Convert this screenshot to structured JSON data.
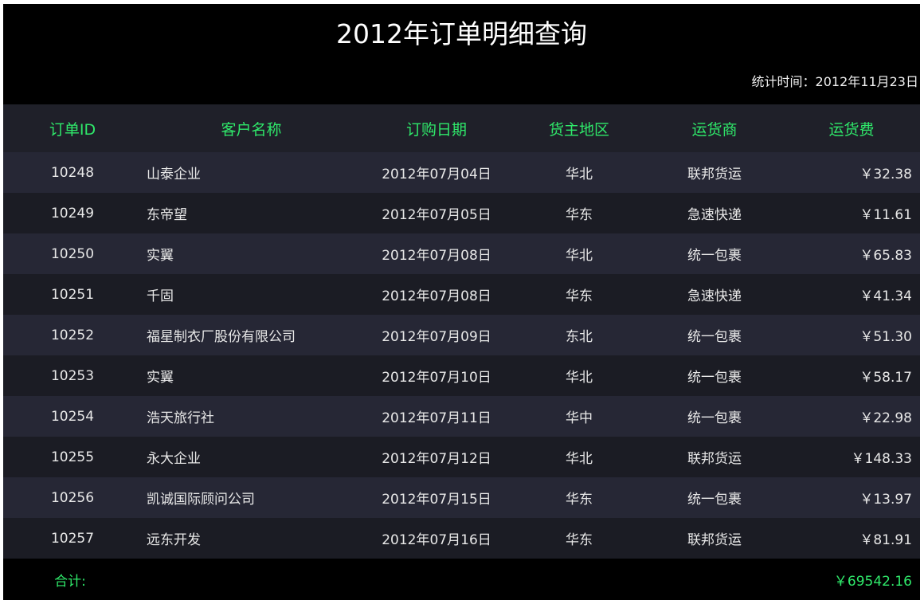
{
  "report": {
    "title": "2012年订单明细查询",
    "stat_time": "统计时间：2012年11月23日"
  },
  "table": {
    "columns": [
      "订单ID",
      "客户名称",
      "订购日期",
      "货主地区",
      "运货商",
      "运货费"
    ],
    "rows": [
      {
        "id": "10248",
        "customer": "山泰企业",
        "date": "2012年07月04日",
        "region": "华北",
        "carrier": "联邦货运",
        "fee": "￥32.38"
      },
      {
        "id": "10249",
        "customer": "东帝望",
        "date": "2012年07月05日",
        "region": "华东",
        "carrier": "急速快递",
        "fee": "￥11.61"
      },
      {
        "id": "10250",
        "customer": "实翼",
        "date": "2012年07月08日",
        "region": "华北",
        "carrier": "统一包裹",
        "fee": "￥65.83"
      },
      {
        "id": "10251",
        "customer": "千固",
        "date": "2012年07月08日",
        "region": "华东",
        "carrier": "急速快递",
        "fee": "￥41.34"
      },
      {
        "id": "10252",
        "customer": "福星制衣厂股份有限公司",
        "date": "2012年07月09日",
        "region": "东北",
        "carrier": "统一包裹",
        "fee": "￥51.30"
      },
      {
        "id": "10253",
        "customer": "实翼",
        "date": "2012年07月10日",
        "region": "华北",
        "carrier": "统一包裹",
        "fee": "￥58.17"
      },
      {
        "id": "10254",
        "customer": "浩天旅行社",
        "date": "2012年07月11日",
        "region": "华中",
        "carrier": "统一包裹",
        "fee": "￥22.98"
      },
      {
        "id": "10255",
        "customer": "永大企业",
        "date": "2012年07月12日",
        "region": "华北",
        "carrier": "联邦货运",
        "fee": "￥148.33"
      },
      {
        "id": "10256",
        "customer": "凯诚国际顾问公司",
        "date": "2012年07月15日",
        "region": "华东",
        "carrier": "统一包裹",
        "fee": "￥13.97"
      },
      {
        "id": "10257",
        "customer": "远东开发",
        "date": "2012年07月16日",
        "region": "华东",
        "carrier": "联邦货运",
        "fee": "￥81.91"
      }
    ]
  },
  "footer": {
    "total_label": "合计:",
    "total_value": "￥69542.16"
  },
  "colors": {
    "background": "#000000",
    "accent_green": "#2fe86a",
    "row_odd": "#262735",
    "row_even": "#1b1c24",
    "header_bg": "#1f2029",
    "text": "#e8e8e8"
  }
}
